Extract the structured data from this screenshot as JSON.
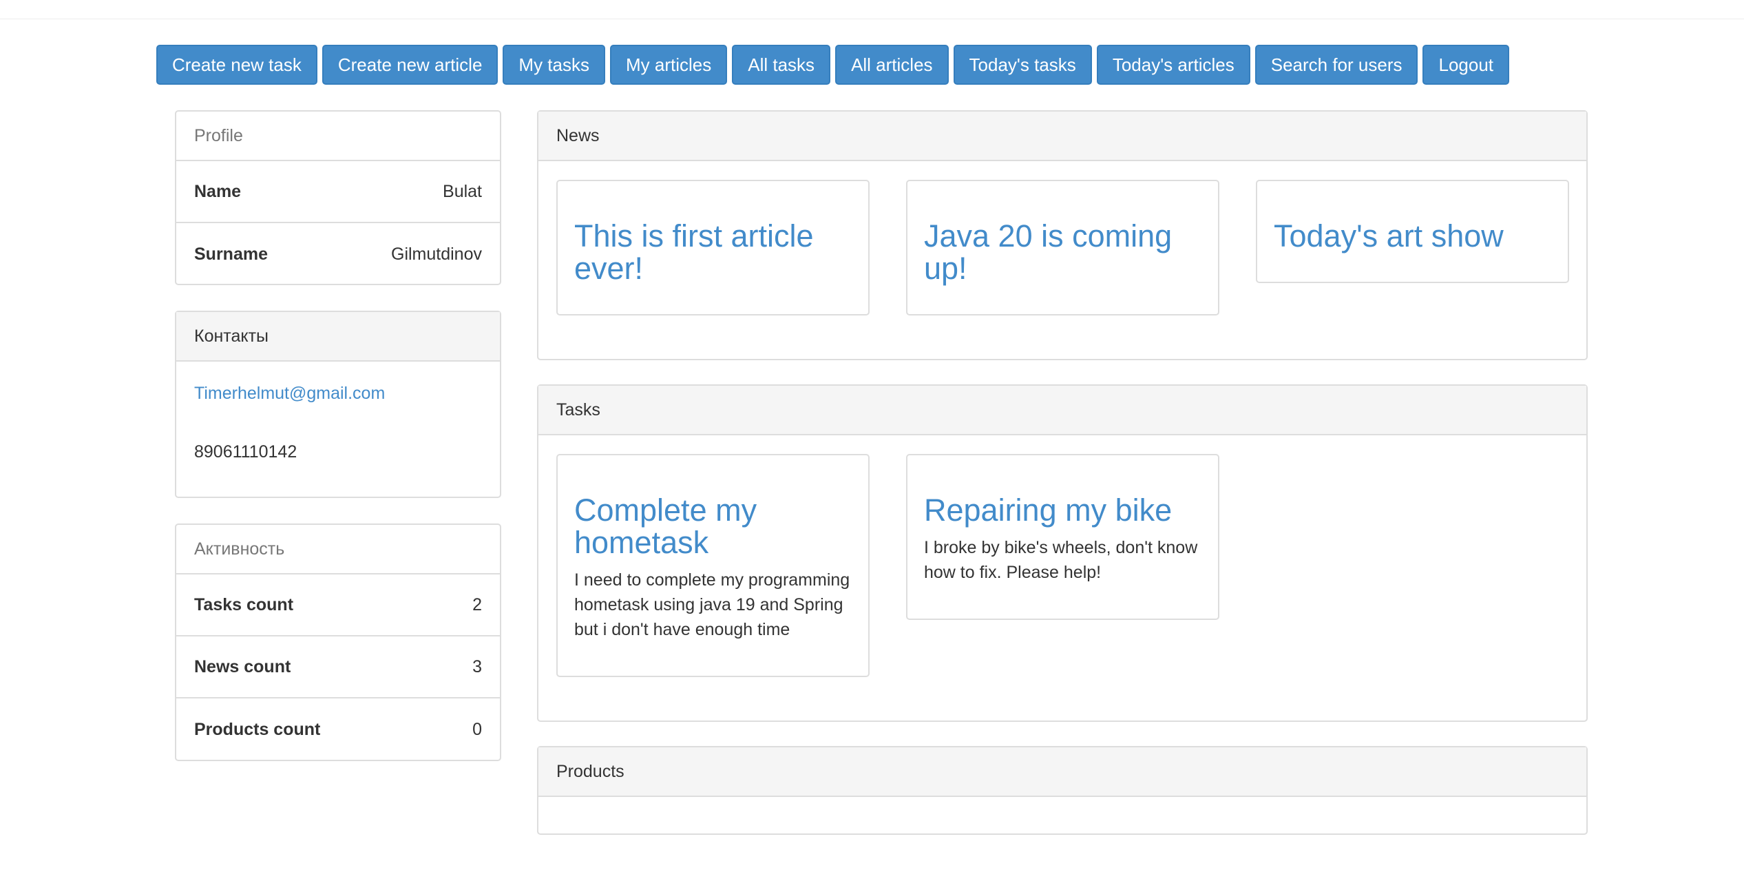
{
  "nav": [
    {
      "label": "Create new task"
    },
    {
      "label": "Create new article"
    },
    {
      "label": "My tasks"
    },
    {
      "label": "My articles"
    },
    {
      "label": "All tasks"
    },
    {
      "label": "All articles"
    },
    {
      "label": "Today's tasks"
    },
    {
      "label": "Today's articles"
    },
    {
      "label": "Search for users"
    },
    {
      "label": "Logout"
    }
  ],
  "profile": {
    "title": "Profile",
    "name_label": "Name",
    "name_value": "Bulat",
    "surname_label": "Surname",
    "surname_value": "Gilmutdinov"
  },
  "contacts": {
    "title": "Контакты",
    "email": "Timerhelmut@gmail.com",
    "phone": "89061110142"
  },
  "activity": {
    "title": "Активность",
    "tasks_label": "Tasks count",
    "tasks_value": "2",
    "news_label": "News count",
    "news_value": "3",
    "products_label": "Products count",
    "products_value": "0"
  },
  "news": {
    "title": "News",
    "articles": [
      {
        "title": "This is first article ever!"
      },
      {
        "title": "Java 20 is coming up!"
      },
      {
        "title": "Today's art show"
      }
    ]
  },
  "tasks": {
    "title": "Tasks",
    "items": [
      {
        "title": "Complete my hometask",
        "description": "I need to complete my programming hometask using java 19 and Spring but i don't have enough time"
      },
      {
        "title": "Repairing my bike",
        "description": "I broke by bike's wheels, don't know how to fix. Please help!"
      }
    ]
  },
  "products": {
    "title": "Products"
  },
  "colors": {
    "primary": "#428bca",
    "panel_heading_bg": "#f5f5f5",
    "border": "#dddddd"
  }
}
